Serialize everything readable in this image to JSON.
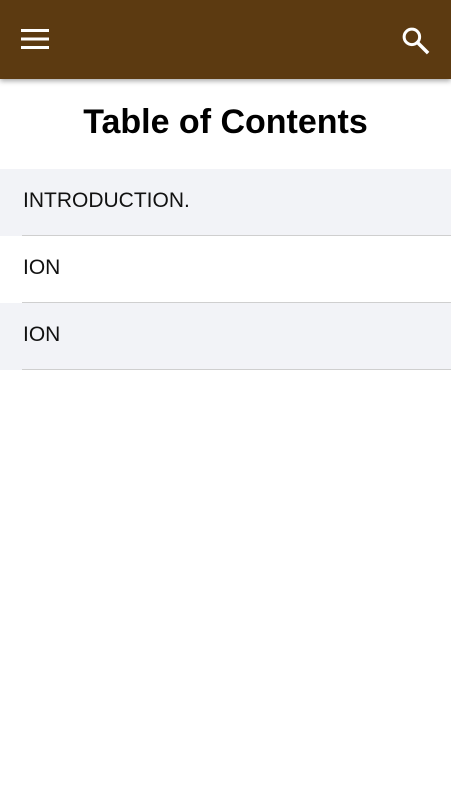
{
  "header": {
    "background_color": "#5c3a11",
    "menu_icon": "hamburger-menu-icon",
    "search_icon": "search-icon"
  },
  "page": {
    "title": "Table of Contents"
  },
  "toc": {
    "items": [
      {
        "label": "INTRODUCTION."
      },
      {
        "label": "ION"
      },
      {
        "label": "ION"
      }
    ]
  }
}
